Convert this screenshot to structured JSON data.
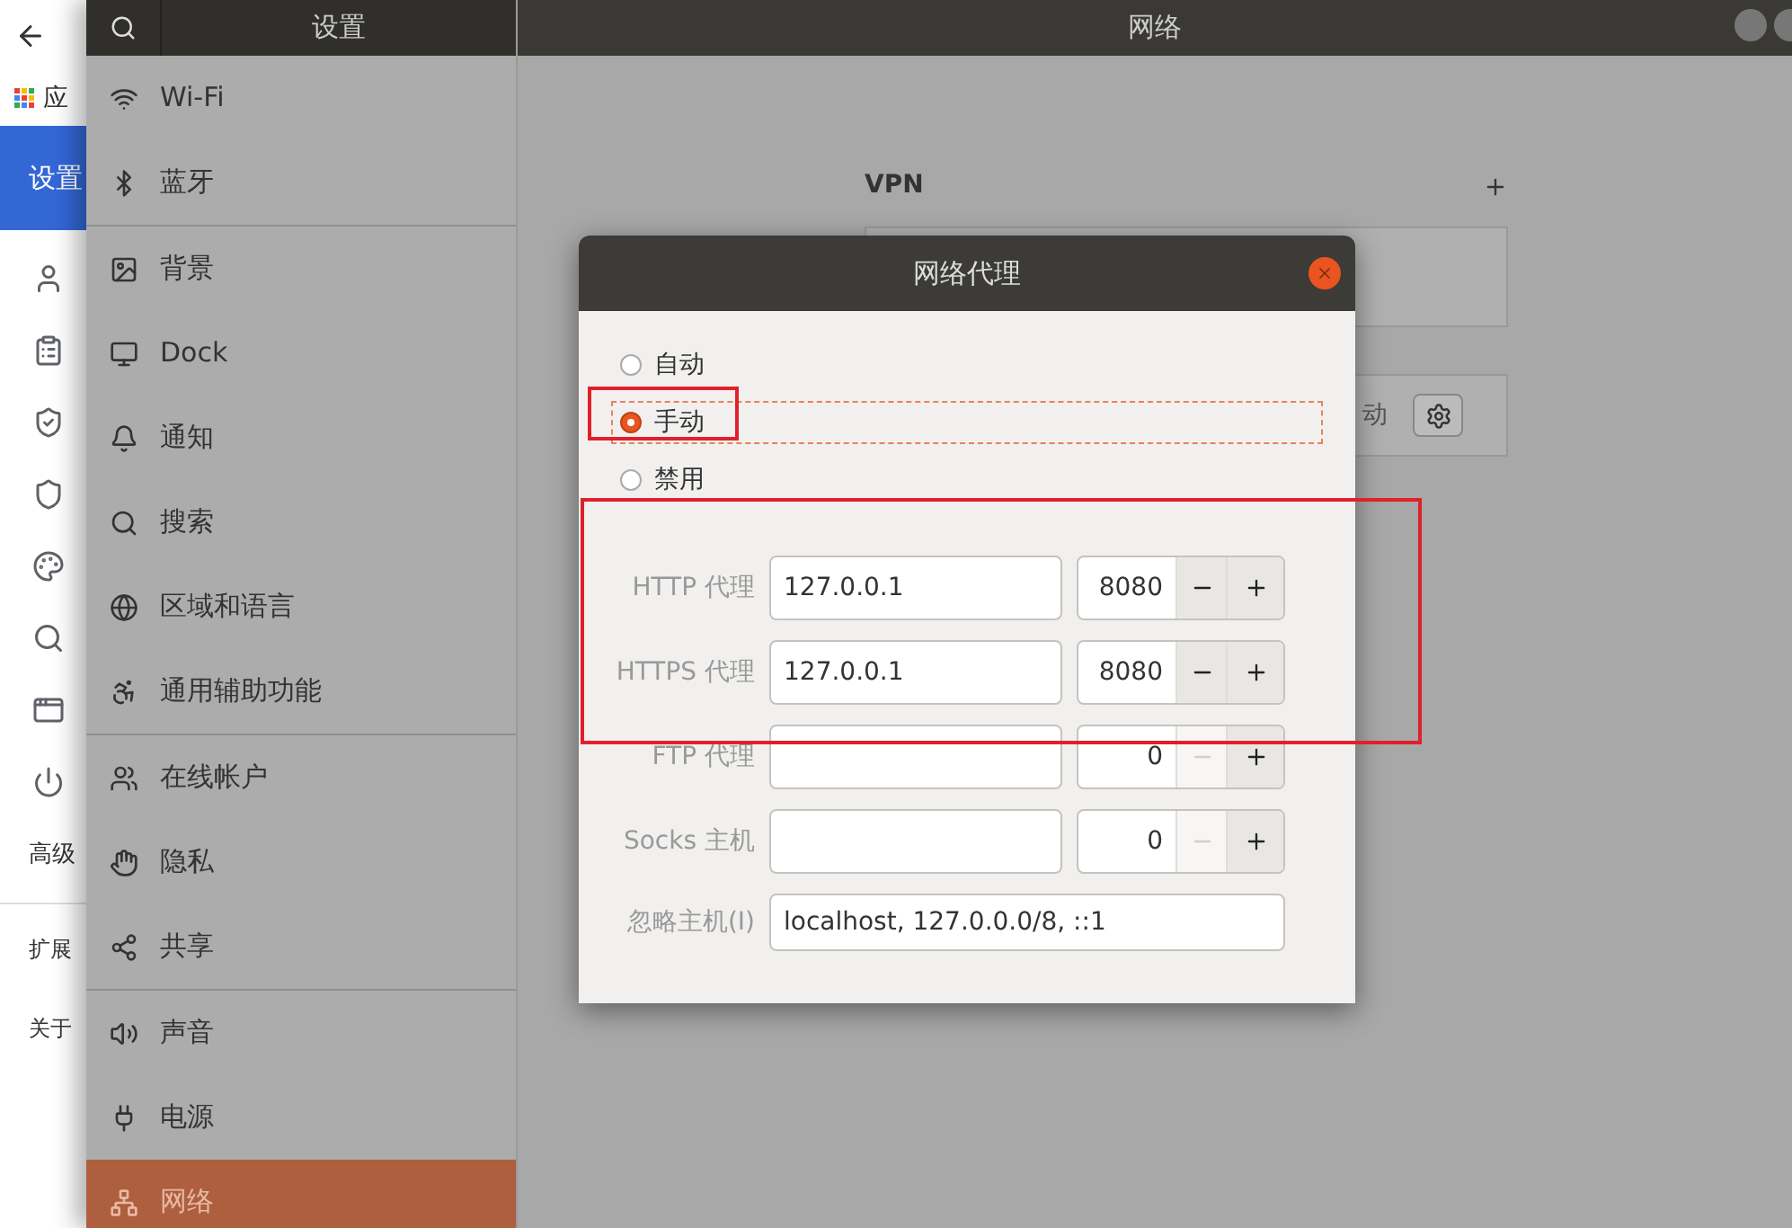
{
  "browser": {
    "apps_label": "应",
    "settings_tab": "设置",
    "advanced": "高级",
    "links": [
      "扩展",
      "关于"
    ]
  },
  "settings": {
    "search_title": "设置",
    "groups": [
      {
        "items": [
          {
            "label": "Wi-Fi",
            "selected": false
          },
          {
            "label": "蓝牙",
            "selected": false
          }
        ]
      },
      {
        "items": [
          {
            "label": "背景",
            "selected": false
          },
          {
            "label": "Dock",
            "selected": false
          },
          {
            "label": "通知",
            "selected": false
          },
          {
            "label": "搜索",
            "selected": false
          },
          {
            "label": "区域和语言",
            "selected": false
          },
          {
            "label": "通用辅助功能",
            "selected": false
          }
        ]
      },
      {
        "items": [
          {
            "label": "在线帐户",
            "selected": false
          },
          {
            "label": "隐私",
            "selected": false
          },
          {
            "label": "共享",
            "selected": false
          }
        ]
      },
      {
        "items": [
          {
            "label": "声音",
            "selected": false
          },
          {
            "label": "电源",
            "selected": false
          },
          {
            "label": "网络",
            "selected": true
          }
        ]
      }
    ]
  },
  "main": {
    "title": "网络",
    "vpn_heading": "VPN",
    "proxy_value": "动"
  },
  "dialog": {
    "title": "网络代理",
    "modes": [
      {
        "label": "自动",
        "selected": false
      },
      {
        "label": "手动",
        "selected": true
      },
      {
        "label": "禁用",
        "selected": false
      }
    ],
    "proxies": [
      {
        "label": "HTTP 代理",
        "host": "127.0.0.1",
        "port": "8080",
        "minus_disabled": false
      },
      {
        "label": "HTTPS 代理",
        "host": "127.0.0.1",
        "port": "8080",
        "minus_disabled": false
      },
      {
        "label": "FTP 代理",
        "port": "0",
        "minus_disabled": true
      },
      {
        "label": "Socks 主机",
        "port": "0",
        "minus_disabled": true
      }
    ],
    "ignore": {
      "label": "忽略主机(I)",
      "value": "localhost, 127.0.0.0/8, ::1"
    }
  }
}
